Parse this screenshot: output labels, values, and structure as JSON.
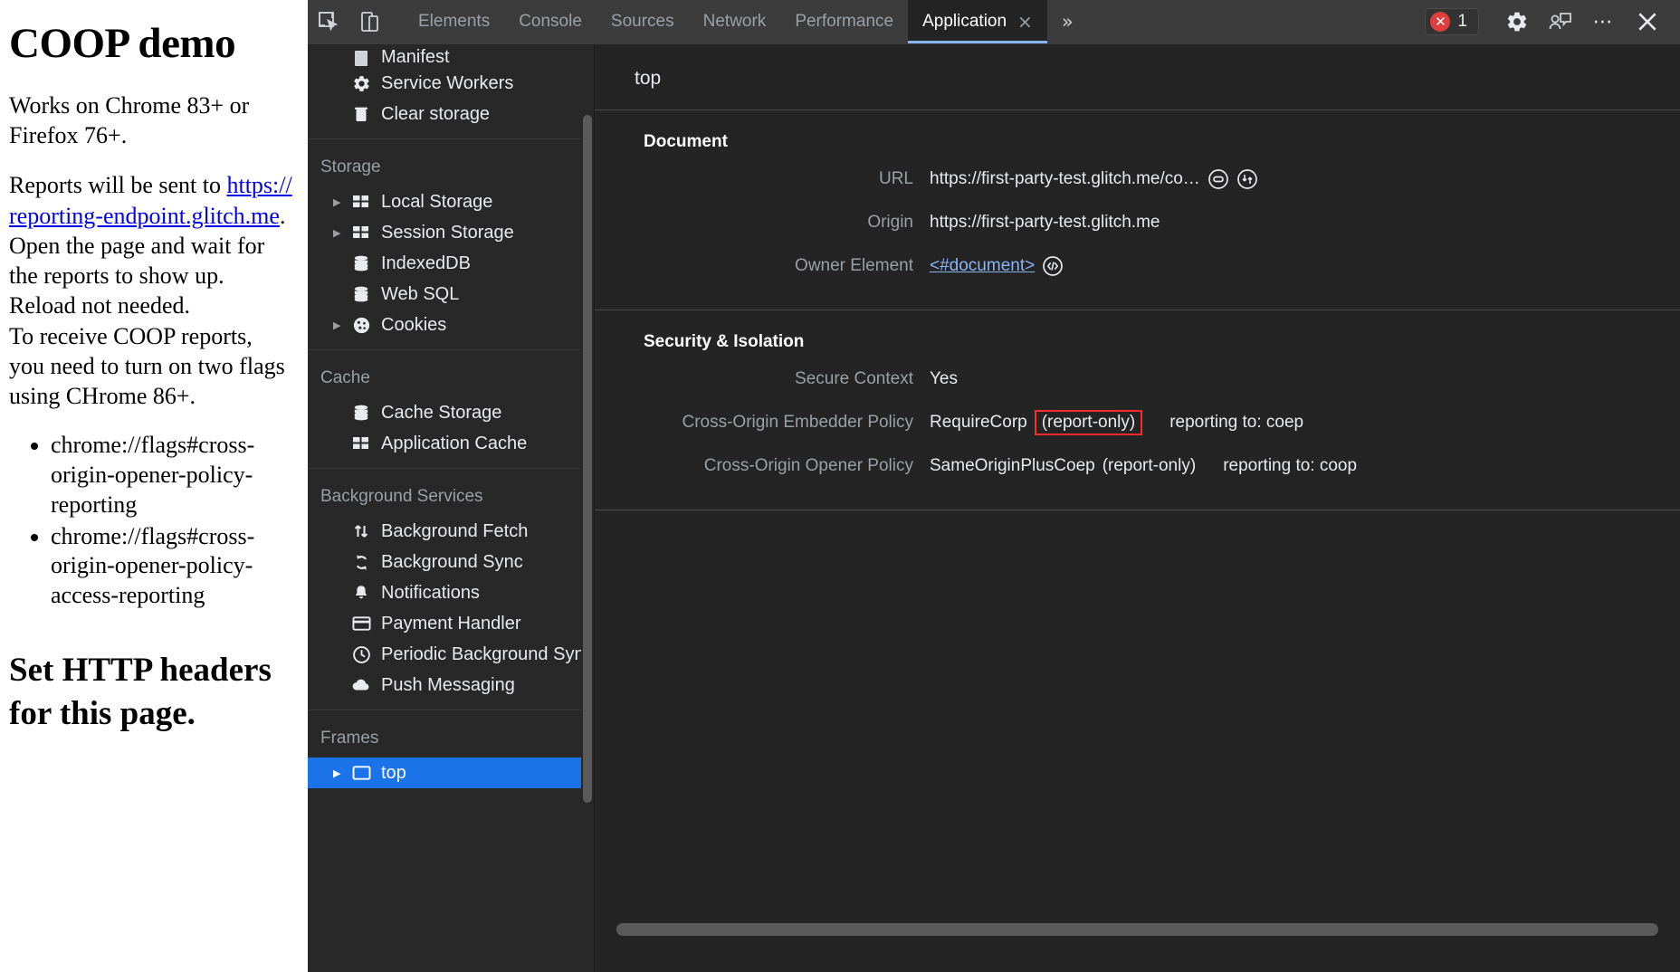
{
  "webpage": {
    "heading": "COOP demo",
    "paragraph1": "Works on Chrome 83+ or Firefox 76+.",
    "paragraph2_pre": "Reports will be sent to ",
    "link_text": "https://reporting-endpoint.glitch.me",
    "paragraph2_post": ".",
    "paragraph3_lines": [
      "Open the page and wait for",
      "the reports to show up.",
      "Reload not needed.",
      "To receive COOP reports,",
      "you need to turn on two flags",
      "using CHrome 86+."
    ],
    "flags": [
      "chrome://flags#cross-origin-opener-policy-reporting",
      "chrome://flags#cross-origin-opener-policy-access-reporting"
    ],
    "subheading": "Set HTTP headers for this page."
  },
  "devtools": {
    "toolbar": {
      "inspect_icon": "inspect-element-icon",
      "device_icon": "device-toolbar-icon",
      "tabs": [
        {
          "label": "Elements",
          "active": false
        },
        {
          "label": "Console",
          "active": false
        },
        {
          "label": "Sources",
          "active": false
        },
        {
          "label": "Network",
          "active": false
        },
        {
          "label": "Performance",
          "active": false
        },
        {
          "label": "Application",
          "active": true
        }
      ],
      "tab_close_glyph": "×",
      "more_tabs_glyph": "»",
      "error_count": "1",
      "settings_icon": "gear-icon",
      "feedback_icon": "feedback-icon",
      "more_options_glyph": "⋯",
      "close_glyph": "✕"
    },
    "sidebar": {
      "groups": [
        {
          "title": "",
          "items": [
            {
              "label": "Manifest",
              "icon": "manifest-icon",
              "arrow": false,
              "clipped": true
            },
            {
              "label": "Service Workers",
              "icon": "gear-icon",
              "arrow": false
            },
            {
              "label": "Clear storage",
              "icon": "trash-icon",
              "arrow": false
            }
          ]
        },
        {
          "title": "Storage",
          "items": [
            {
              "label": "Local Storage",
              "icon": "table-icon",
              "arrow": true
            },
            {
              "label": "Session Storage",
              "icon": "table-icon",
              "arrow": true
            },
            {
              "label": "IndexedDB",
              "icon": "database-icon",
              "arrow": false
            },
            {
              "label": "Web SQL",
              "icon": "database-icon",
              "arrow": false
            },
            {
              "label": "Cookies",
              "icon": "cookie-icon",
              "arrow": true
            }
          ]
        },
        {
          "title": "Cache",
          "items": [
            {
              "label": "Cache Storage",
              "icon": "database-icon",
              "arrow": false
            },
            {
              "label": "Application Cache",
              "icon": "table-icon",
              "arrow": false
            }
          ]
        },
        {
          "title": "Background Services",
          "items": [
            {
              "label": "Background Fetch",
              "icon": "updown-arrows-icon",
              "arrow": false
            },
            {
              "label": "Background Sync",
              "icon": "sync-icon",
              "arrow": false
            },
            {
              "label": "Notifications",
              "icon": "bell-icon",
              "arrow": false
            },
            {
              "label": "Payment Handler",
              "icon": "credit-card-icon",
              "arrow": false
            },
            {
              "label": "Periodic Background Sync",
              "icon": "clock-icon",
              "arrow": false
            },
            {
              "label": "Push Messaging",
              "icon": "cloud-icon",
              "arrow": false
            }
          ]
        },
        {
          "title": "Frames",
          "items": [
            {
              "label": "top",
              "icon": "frame-icon",
              "arrow": true,
              "selected": true
            }
          ]
        }
      ]
    },
    "main": {
      "frame_title": "top",
      "sections": [
        {
          "title": "Document",
          "rows": [
            {
              "label": "URL",
              "value": "https://first-party-test.glitch.me/co…",
              "icons": [
                "open-in-sources-icon",
                "reveal-in-network-icon"
              ]
            },
            {
              "label": "Origin",
              "value": "https://first-party-test.glitch.me",
              "icons": []
            },
            {
              "label": "Owner Element",
              "value": "<#document>",
              "is_link": true,
              "icons": [
                "reveal-in-elements-icon"
              ]
            }
          ]
        },
        {
          "title": "Security & Isolation",
          "rows": [
            {
              "label": "Secure Context",
              "value": "Yes",
              "icons": []
            },
            {
              "label": "Cross-Origin Embedder Policy",
              "value": "RequireCorp",
              "badge": "(report-only)",
              "badge_highlighted": true,
              "reporting": "reporting to: coep",
              "icons": []
            },
            {
              "label": "Cross-Origin Opener Policy",
              "value": "SameOriginPlusCoep",
              "badge": "(report-only)",
              "badge_highlighted": false,
              "reporting": "reporting to: coop",
              "icons": []
            }
          ]
        }
      ]
    }
  },
  "colors": {
    "accent_blue": "#1a73e8",
    "link_blue": "#8ab4f8",
    "error_red": "#e03e3e",
    "highlight_red": "#ff2b2b",
    "page_link": "#0000ee"
  }
}
